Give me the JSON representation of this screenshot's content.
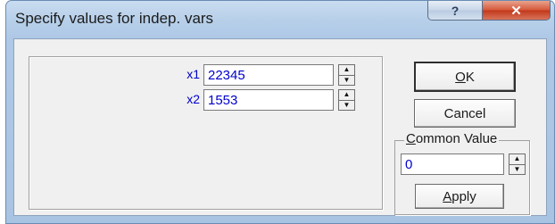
{
  "dialog": {
    "title": "Specify values for indep. vars",
    "help_glyph": "?",
    "close_glyph": "✕"
  },
  "variables": [
    {
      "label": "x1",
      "value": "22345"
    },
    {
      "label": "x2",
      "value": "1553"
    }
  ],
  "spinner": {
    "up_glyph": "▲",
    "down_glyph": "▼"
  },
  "buttons": {
    "ok_mnemonic": "O",
    "ok_rest": "K",
    "cancel": "Cancel",
    "apply_mnemonic": "A",
    "apply_rest": "pply"
  },
  "common_value": {
    "legend_mnemonic": "C",
    "legend_rest": "ommon Value",
    "value": "0"
  },
  "colors": {
    "title_bar": "#b7cfe9",
    "close_button": "#c2391b",
    "variable_text": "#0000cc",
    "client_background": "#f0f0f0"
  },
  "icons": {
    "help": "question-mark-icon",
    "close": "close-x-icon",
    "spin": "spin-arrows-icon"
  }
}
